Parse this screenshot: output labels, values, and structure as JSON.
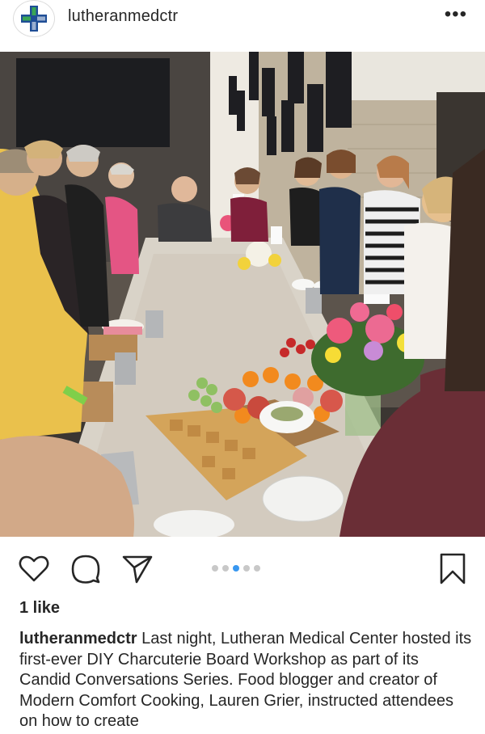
{
  "post": {
    "username": "lutheranmedctr",
    "more_icon": "more-horizontal-icon",
    "likes_text": "1 like",
    "caption_user": "lutheranmedctr",
    "caption_text": "Last night, Lutheran Medical Center hosted its first-ever DIY Charcuterie Board Workshop as part of its Candid Conversations Series. Food blogger and creator of Modern Comfort Cooking, Lauren Grier, instructed attendees on how to create",
    "carousel": {
      "count": 5,
      "active_index": 2
    }
  },
  "icons": {
    "logo": "cross-logo-icon",
    "like": "heart-icon",
    "comment": "comment-icon",
    "share": "send-icon",
    "save": "bookmark-icon",
    "tag": "user-tag-icon"
  },
  "colors": {
    "logo_blue": "#1f4e96",
    "logo_green": "#3aa655",
    "carousel_active": "#3897f0",
    "carousel_inactive": "#c8c8c8"
  }
}
